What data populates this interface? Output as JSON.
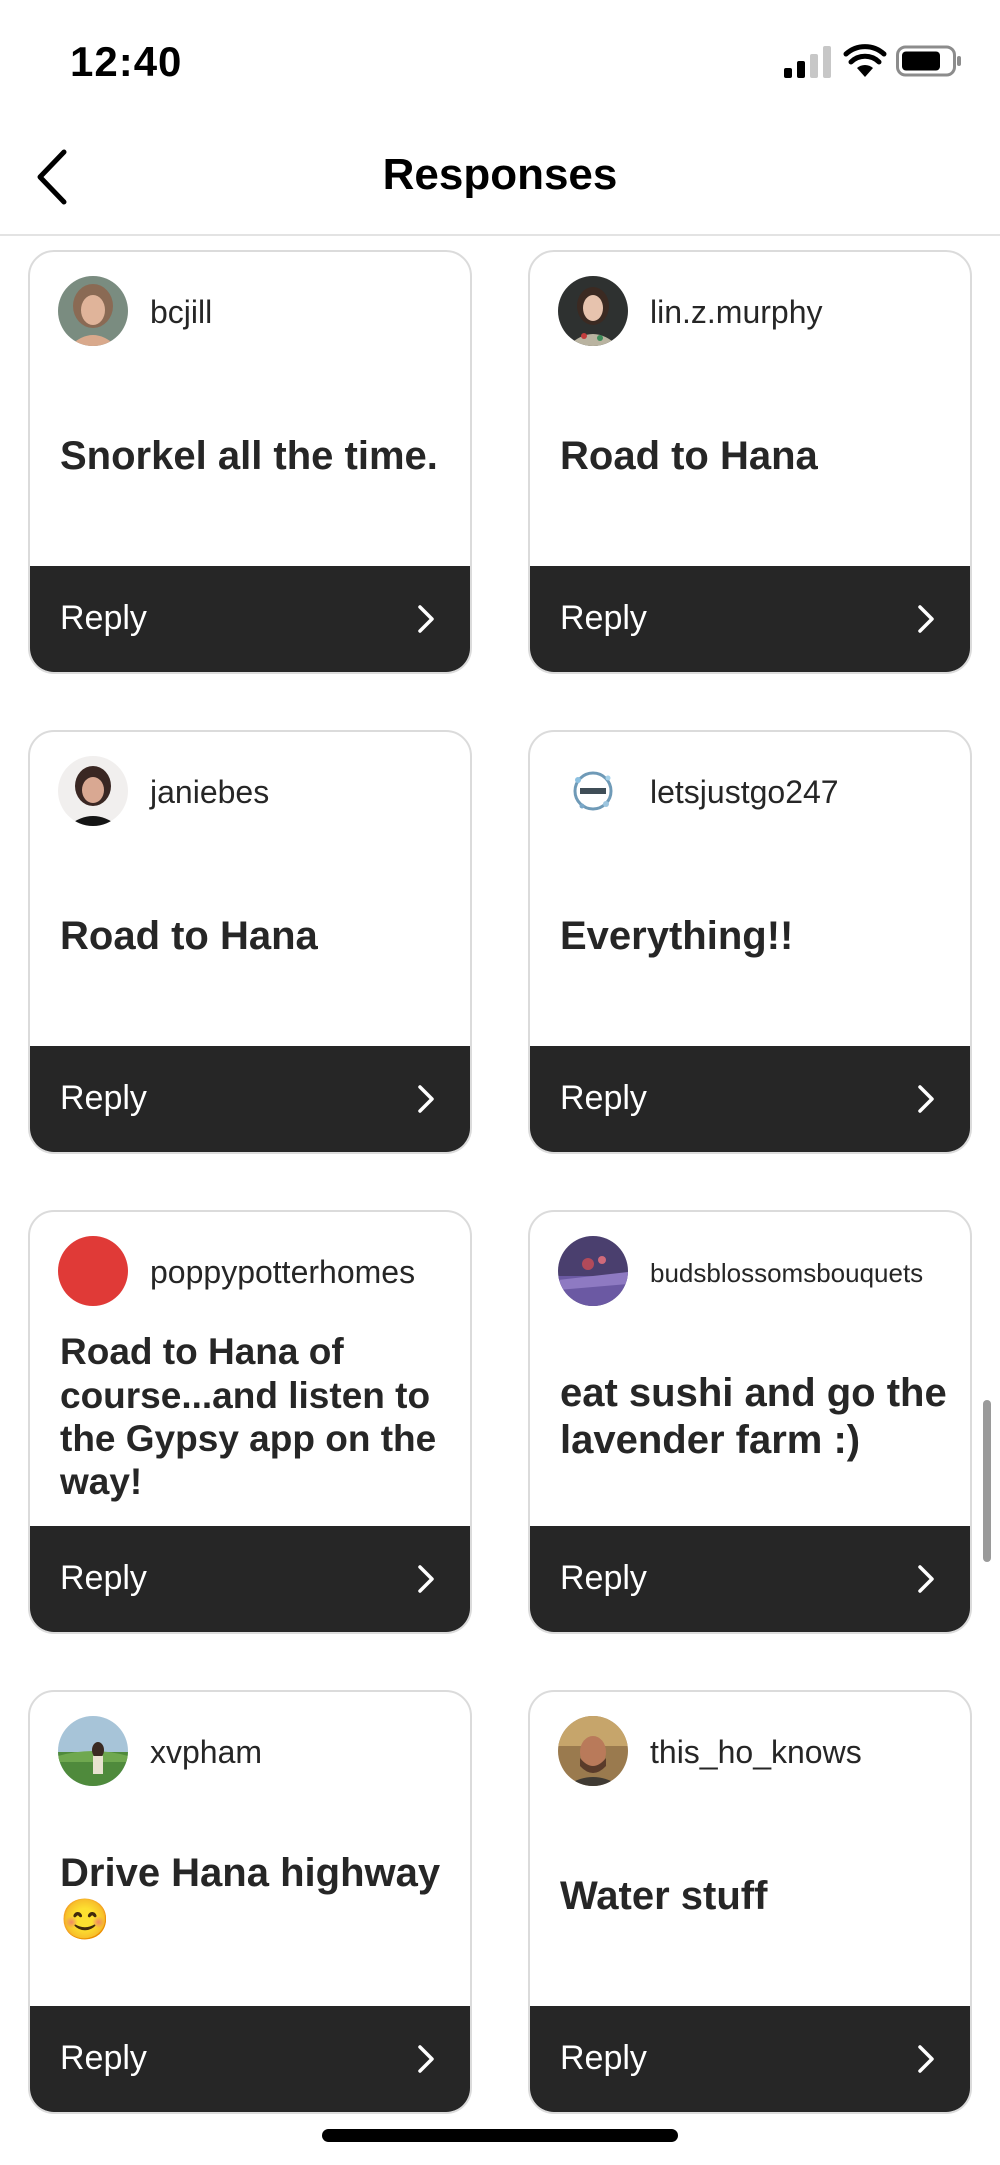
{
  "status_bar": {
    "time": "12:40"
  },
  "header": {
    "title": "Responses"
  },
  "reply_label": "Reply",
  "cards": [
    {
      "username": "bcjill",
      "text": "Snorkel all the time."
    },
    {
      "username": "lin.z.murphy",
      "text": "Road to Hana"
    },
    {
      "username": "janiebes",
      "text": "Road to Hana"
    },
    {
      "username": "letsjustgo247",
      "text": "Everything!!"
    },
    {
      "username": "poppypotterhomes",
      "text": "Road to Hana of course...and listen to the Gypsy app on the way!"
    },
    {
      "username": "budsblossomsbouquets",
      "text": "eat sushi and go the lavender farm :)"
    },
    {
      "username": "xvpham",
      "text": "Drive Hana highway 😊"
    },
    {
      "username": "this_ho_knows",
      "text": "Water stuff"
    }
  ],
  "colors": {
    "reply_bar": "#262626",
    "poppy_avatar": "#e03a37",
    "card_border": "#dbdbdb"
  }
}
